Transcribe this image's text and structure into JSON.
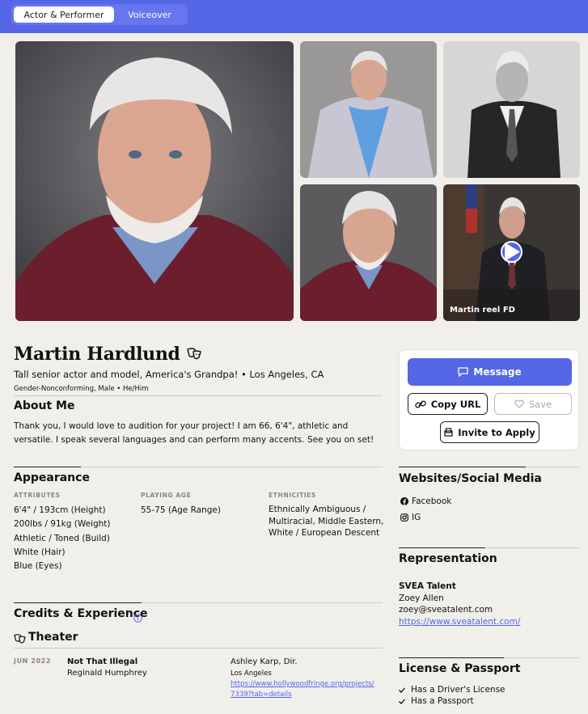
{
  "tabs": [
    {
      "label": "Actor & Performer"
    },
    {
      "label": "Voiceover"
    }
  ],
  "gallery": {
    "reel_label": "Martin reel FD"
  },
  "profile": {
    "name": "Martin Hardlund",
    "tagline": "Tall senior actor and model, America's Grandpa! • Los Angeles, CA",
    "gender_pronouns": "Gender-Nonconforming, Male • He/Him"
  },
  "about": {
    "heading": "About Me",
    "text": "Thank you, I would love to audition for your project! I am 66, 6'4\", athletic and versatile. I speak several languages and can perform many accents. See you on set!"
  },
  "appearance": {
    "heading": "Appearance",
    "attributes_label": "ATTRIBUTES",
    "attributes": [
      "6'4\" / 193cm (Height)",
      "200lbs / 91kg (Weight)",
      "Athletic / Toned (Build)",
      "White (Hair)",
      "Blue (Eyes)"
    ],
    "playing_age_label": "PLAYING AGE",
    "playing_age": "55-75 (Age Range)",
    "ethnicities_label": "ETHNICITIES",
    "ethnicities": [
      "Ethnically Ambiguous /",
      "Multiracial, Middle Eastern,",
      "White / European Descent"
    ]
  },
  "credits": {
    "heading": "Credits & Experience",
    "theater_heading": "Theater",
    "items": [
      {
        "date": "JUN 2022",
        "title": "Not That Illegal",
        "role": "Reginald Humphrey",
        "director": "Ashley Karp, Dir.",
        "location": "Los Angeles",
        "link_line1": "https://www.hollywoodfringe.org/projects/",
        "link_line2": "7339?tab=details"
      }
    ]
  },
  "actions": {
    "message": "Message",
    "copy_url": "Copy URL",
    "save": "Save",
    "invite": "Invite to Apply"
  },
  "websites": {
    "heading": "Websites/Social Media",
    "items": [
      {
        "label": "Facebook",
        "icon": "facebook-icon"
      },
      {
        "label": "IG",
        "icon": "instagram-icon"
      }
    ]
  },
  "representation": {
    "heading": "Representation",
    "agency": "SVEA Talent",
    "agent": "Zoey Allen",
    "email": "zoey@sveatalent.com",
    "url": "https://www.sveatalent.com/"
  },
  "license": {
    "heading": "License & Passport",
    "items": [
      "Has a Driver's License",
      "Has a Passport"
    ]
  },
  "colors": {
    "accent": "#5566e6",
    "background": "#f1efea"
  }
}
